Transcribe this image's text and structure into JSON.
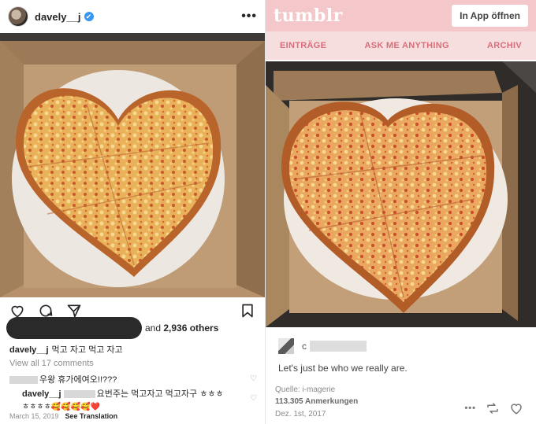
{
  "instagram": {
    "username": "davely__j",
    "verified_mark": "✔",
    "more_label": "•••",
    "icons": [
      "heart-icon",
      "comment-icon",
      "share-icon",
      "bookmark-icon"
    ],
    "likes": {
      "text_prefix": "and ",
      "count": "2,936 others"
    },
    "caption": {
      "username": "davely__j",
      "text": "먹고 자고 먹고 자고"
    },
    "view_all_comments": "View all 17 comments",
    "comments": [
      {
        "text": "우왕 휴가에여오!!???"
      },
      {
        "username": "davely__j",
        "text": "요번주는 먹고자고 먹고자구 ㅎㅎㅎ",
        "line2": "ㅎㅎㅎㅎ🥰🥰🥰🥰❤️"
      }
    ],
    "date": "March 15, 2019",
    "see_translation": "See Translation"
  },
  "tumblr": {
    "logo": "tumblr",
    "open_app_button": "In App öffnen",
    "nav": [
      "EINTRÄGE",
      "ASK ME ANYTHING",
      "ARCHIV"
    ],
    "user_prefix": "c",
    "post_text": "Let's just be who we really are.",
    "source": "Quelle: i-magerie",
    "notes": "113.305 Anmerkungen",
    "date": "Dez. 1st, 2017",
    "more_label": "•••",
    "colors": {
      "header_bg": "#f4c8cb",
      "nav_bg": "#f7dede",
      "nav_text": "#d86e7a"
    }
  }
}
